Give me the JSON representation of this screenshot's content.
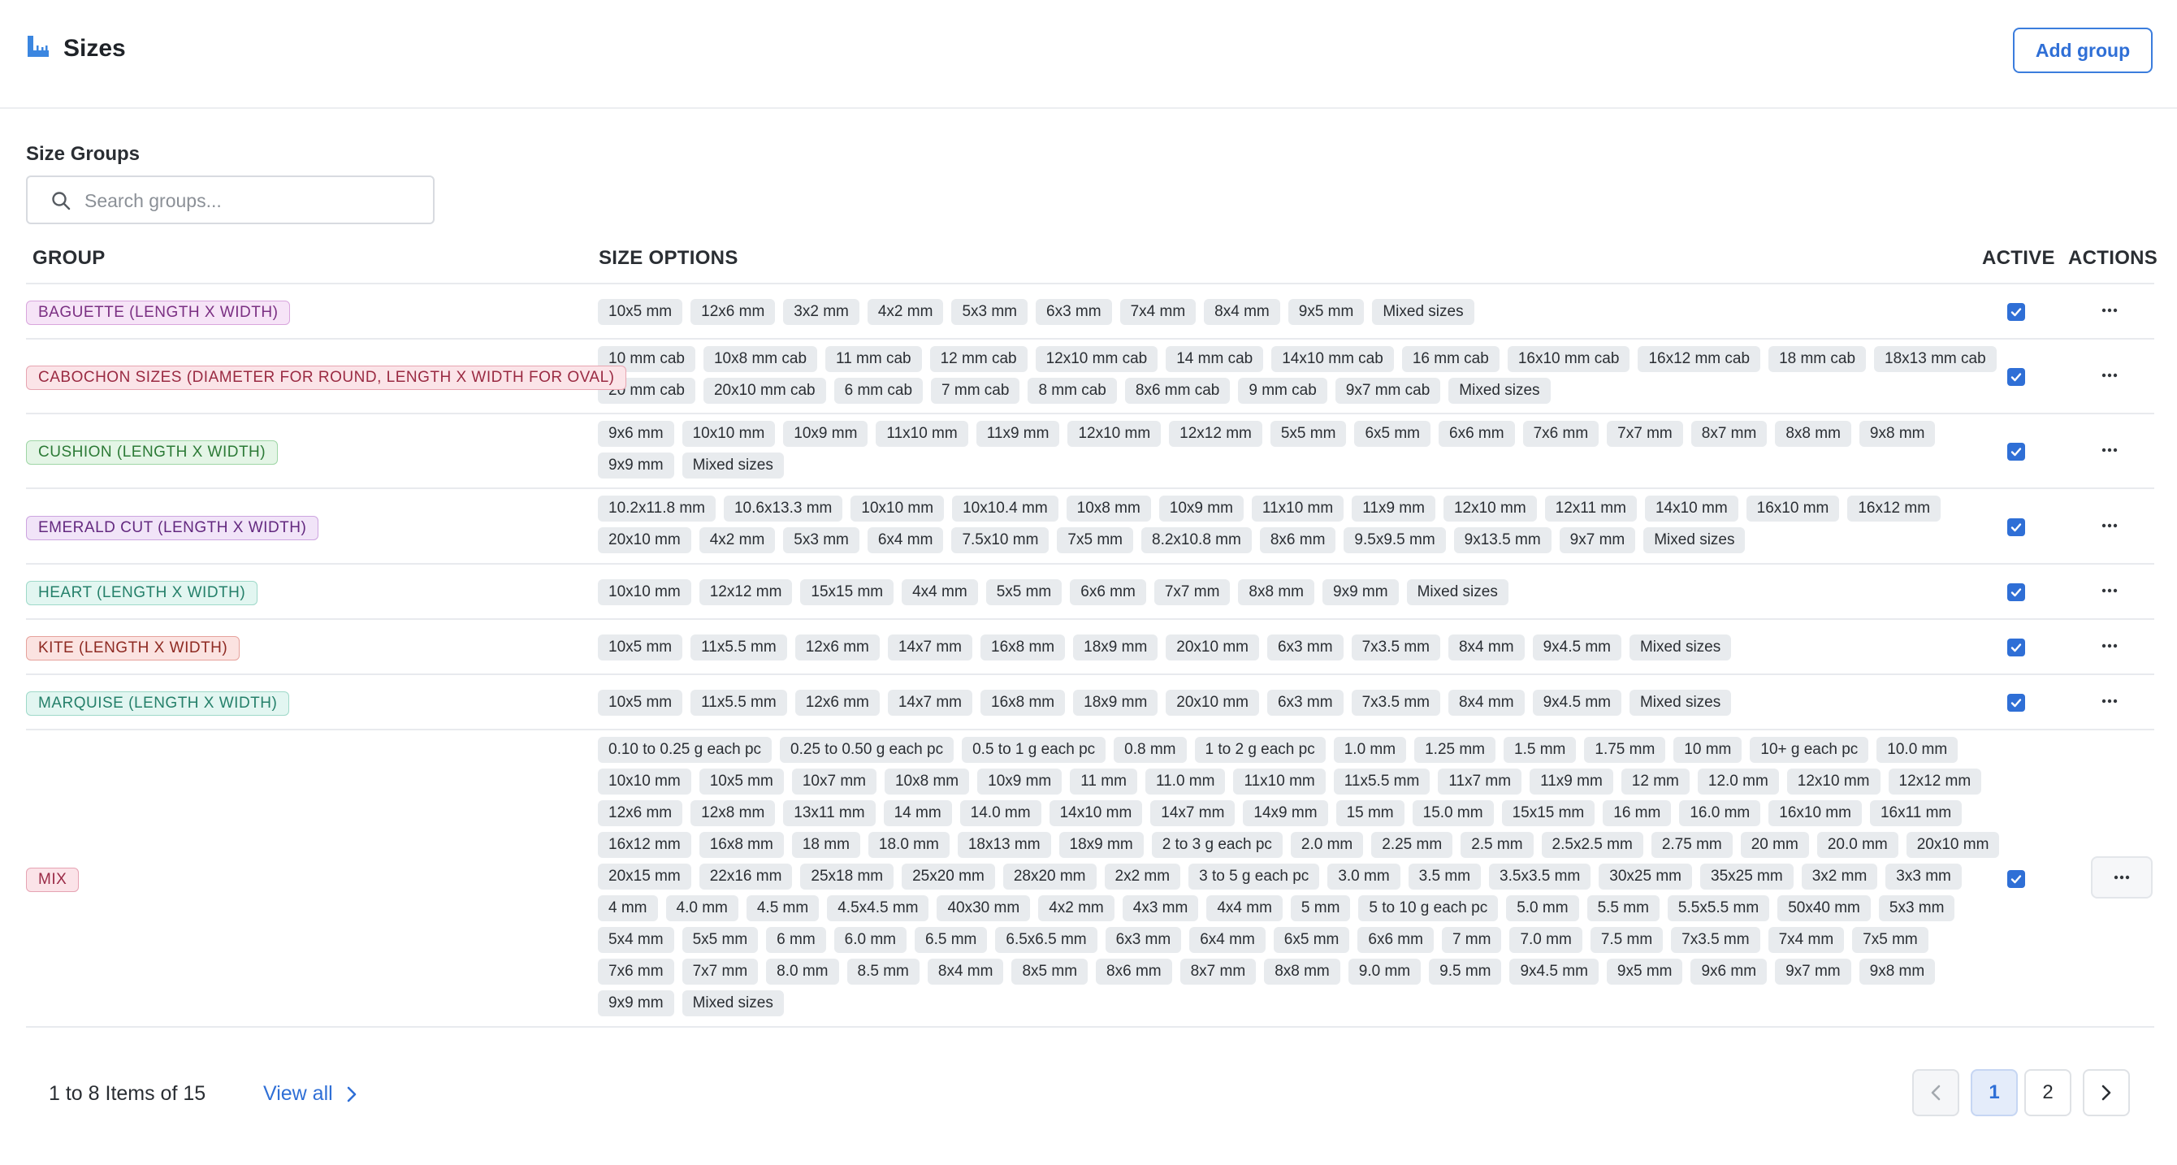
{
  "header": {
    "title": "Sizes",
    "add_group_label": "Add group"
  },
  "section": {
    "title": "Size Groups"
  },
  "search": {
    "placeholder": "Search groups..."
  },
  "table": {
    "columns": [
      "GROUP",
      "SIZE OPTIONS",
      "ACTIVE",
      "ACTIONS"
    ]
  },
  "colors": {
    "accent": "#2f6fd6",
    "chip_bg": "#e8ebee"
  },
  "rows": [
    {
      "group": "BAGUETTE (LENGTH X WIDTH)",
      "badge": {
        "bg": "#f6e4f7",
        "border": "#d9a6dd",
        "fg": "#7a2f82"
      },
      "active": true,
      "options": [
        "10x5 mm",
        "12x6 mm",
        "3x2 mm",
        "4x2 mm",
        "5x3 mm",
        "6x3 mm",
        "7x4 mm",
        "8x4 mm",
        "9x5 mm",
        "Mixed sizes"
      ]
    },
    {
      "group": "CABOCHON SIZES (DIAMETER FOR ROUND, LENGTH X WIDTH FOR OVAL)",
      "badge": {
        "bg": "#fbe4e8",
        "border": "#e7a5b1",
        "fg": "#9a2a42"
      },
      "active": true,
      "options": [
        "10 mm cab",
        "10x8 mm cab",
        "11 mm cab",
        "12 mm cab",
        "12x10 mm cab",
        "14 mm cab",
        "14x10 mm cab",
        "16 mm cab",
        "16x10 mm cab",
        "16x12 mm cab",
        "18 mm cab",
        "18x13 mm cab",
        "20 mm cab",
        "20x10 mm cab",
        "6 mm cab",
        "7 mm cab",
        "8 mm cab",
        "8x6 mm cab",
        "9 mm cab",
        "9x7 mm cab",
        "Mixed sizes"
      ]
    },
    {
      "group": "CUSHION (LENGTH X WIDTH)",
      "badge": {
        "bg": "#e4f5e6",
        "border": "#9fd6a6",
        "fg": "#2c7a36"
      },
      "active": true,
      "options": [
        "9x6 mm",
        "10x10 mm",
        "10x9 mm",
        "11x10 mm",
        "11x9 mm",
        "12x10 mm",
        "12x12 mm",
        "5x5 mm",
        "6x5 mm",
        "6x6 mm",
        "7x6 mm",
        "7x7 mm",
        "8x7 mm",
        "8x8 mm",
        "9x8 mm",
        "9x9 mm",
        "Mixed sizes"
      ]
    },
    {
      "group": "EMERALD CUT (LENGTH X WIDTH)",
      "badge": {
        "bg": "#f1e4f8",
        "border": "#cda5e0",
        "fg": "#63287f"
      },
      "active": true,
      "options": [
        "10.2x11.8 mm",
        "10.6x13.3 mm",
        "10x10 mm",
        "10x10.4 mm",
        "10x8 mm",
        "10x9 mm",
        "11x10 mm",
        "11x9 mm",
        "12x10 mm",
        "12x11 mm",
        "14x10 mm",
        "16x10 mm",
        "16x12 mm",
        "20x10 mm",
        "4x2 mm",
        "5x3 mm",
        "6x4 mm",
        "7.5x10 mm",
        "7x5 mm",
        "8.2x10.8 mm",
        "8x6 mm",
        "9.5x9.5 mm",
        "9x13.5 mm",
        "9x7 mm",
        "Mixed sizes"
      ]
    },
    {
      "group": "HEART (LENGTH X WIDTH)",
      "badge": {
        "bg": "#e2f6f1",
        "border": "#9fd9c9",
        "fg": "#25806a"
      },
      "active": true,
      "options": [
        "10x10 mm",
        "12x12 mm",
        "15x15 mm",
        "4x4 mm",
        "5x5 mm",
        "6x6 mm",
        "7x7 mm",
        "8x8 mm",
        "9x9 mm",
        "Mixed sizes"
      ]
    },
    {
      "group": "KITE (LENGTH X WIDTH)",
      "badge": {
        "bg": "#fbe3e1",
        "border": "#e6a29c",
        "fg": "#8e2a22"
      },
      "active": true,
      "options": [
        "10x5 mm",
        "11x5.5 mm",
        "12x6 mm",
        "14x7 mm",
        "16x8 mm",
        "18x9 mm",
        "20x10 mm",
        "6x3 mm",
        "7x3.5 mm",
        "8x4 mm",
        "9x4.5 mm",
        "Mixed sizes"
      ]
    },
    {
      "group": "MARQUISE (LENGTH X WIDTH)",
      "badge": {
        "bg": "#e2f6f1",
        "border": "#9fd9c9",
        "fg": "#25806a"
      },
      "active": true,
      "options": [
        "10x5 mm",
        "11x5.5 mm",
        "12x6 mm",
        "14x7 mm",
        "16x8 mm",
        "18x9 mm",
        "20x10 mm",
        "6x3 mm",
        "7x3.5 mm",
        "8x4 mm",
        "9x4.5 mm",
        "Mixed sizes"
      ]
    },
    {
      "group": "MIX",
      "badge": {
        "bg": "#fbe3e8",
        "border": "#e6a3b3",
        "fg": "#9a2a46"
      },
      "active": true,
      "options": [
        "0.10 to 0.25 g each pc",
        "0.25 to 0.50 g each pc",
        "0.5 to 1 g each pc",
        "0.8 mm",
        "1 to 2 g each pc",
        "1.0 mm",
        "1.25 mm",
        "1.5 mm",
        "1.75 mm",
        "10 mm",
        "10+ g each pc",
        "10.0 mm",
        "10x10 mm",
        "10x5 mm",
        "10x7 mm",
        "10x8 mm",
        "10x9 mm",
        "11 mm",
        "11.0 mm",
        "11x10 mm",
        "11x5.5 mm",
        "11x7 mm",
        "11x9 mm",
        "12 mm",
        "12.0 mm",
        "12x10 mm",
        "12x12 mm",
        "12x6 mm",
        "12x8 mm",
        "13x11 mm",
        "14 mm",
        "14.0 mm",
        "14x10 mm",
        "14x7 mm",
        "14x9 mm",
        "15 mm",
        "15.0 mm",
        "15x15 mm",
        "16 mm",
        "16.0 mm",
        "16x10 mm",
        "16x11 mm",
        "16x12 mm",
        "16x8 mm",
        "18 mm",
        "18.0 mm",
        "18x13 mm",
        "18x9 mm",
        "2 to 3 g each pc",
        "2.0 mm",
        "2.25 mm",
        "2.5 mm",
        "2.5x2.5 mm",
        "2.75 mm",
        "20 mm",
        "20.0 mm",
        "20x10 mm",
        "20x15 mm",
        "22x16 mm",
        "25x18 mm",
        "25x20 mm",
        "28x20 mm",
        "2x2 mm",
        "3 to 5 g each pc",
        "3.0 mm",
        "3.5 mm",
        "3.5x3.5 mm",
        "30x25 mm",
        "35x25 mm",
        "3x2 mm",
        "3x3 mm",
        "4 mm",
        "4.0 mm",
        "4.5 mm",
        "4.5x4.5 mm",
        "40x30 mm",
        "4x2 mm",
        "4x3 mm",
        "4x4 mm",
        "5 mm",
        "5 to 10 g each pc",
        "5.0 mm",
        "5.5 mm",
        "5.5x5.5 mm",
        "50x40 mm",
        "5x3 mm",
        "5x4 mm",
        "5x5 mm",
        "6 mm",
        "6.0 mm",
        "6.5 mm",
        "6.5x6.5 mm",
        "6x3 mm",
        "6x4 mm",
        "6x5 mm",
        "6x6 mm",
        "7 mm",
        "7.0 mm",
        "7.5 mm",
        "7x3.5 mm",
        "7x4 mm",
        "7x5 mm",
        "7x6 mm",
        "7x7 mm",
        "8.0 mm",
        "8.5 mm",
        "8x4 mm",
        "8x5 mm",
        "8x6 mm",
        "8x7 mm",
        "8x8 mm",
        "9.0 mm",
        "9.5 mm",
        "9x4.5 mm",
        "9x5 mm",
        "9x6 mm",
        "9x7 mm",
        "9x8 mm",
        "9x9 mm",
        "Mixed sizes"
      ]
    }
  ],
  "footer": {
    "count_text": "1 to 8 Items of 15",
    "view_all_label": "View all",
    "pages": [
      "1",
      "2"
    ],
    "current_page": "1"
  }
}
